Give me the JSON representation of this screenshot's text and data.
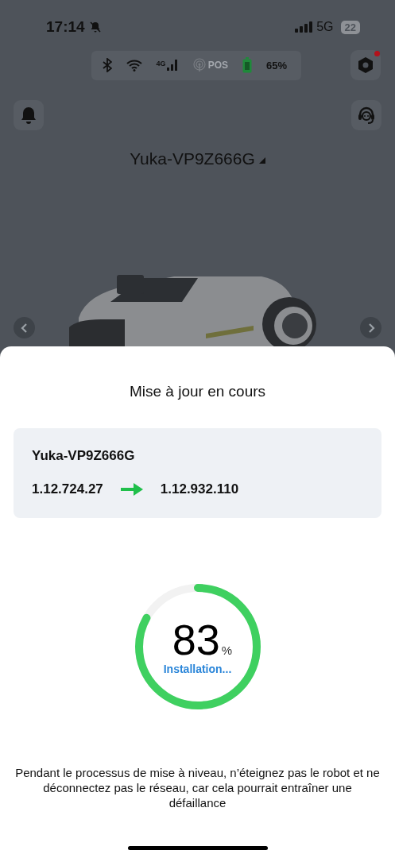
{
  "status_bar": {
    "time": "17:14",
    "network": "5G",
    "battery": "22"
  },
  "robot_status": {
    "cellular": "4G",
    "positioning": "POS",
    "battery": "65%"
  },
  "device_selector": {
    "name": "Yuka-VP9Z666G"
  },
  "update_dialog": {
    "title": "Mise à jour en cours",
    "device": "Yuka-VP9Z666G",
    "from_version": "1.12.724.27",
    "to_version": "1.12.932.110",
    "progress": {
      "level": 0.83,
      "value": "83",
      "unit": "%",
      "status": "Installation..."
    },
    "warning": "Pendant le processus de mise à niveau, n’éteignez pas le robot et ne déconnectez pas le réseau, car cela pourrait entraîner une défaillance"
  }
}
